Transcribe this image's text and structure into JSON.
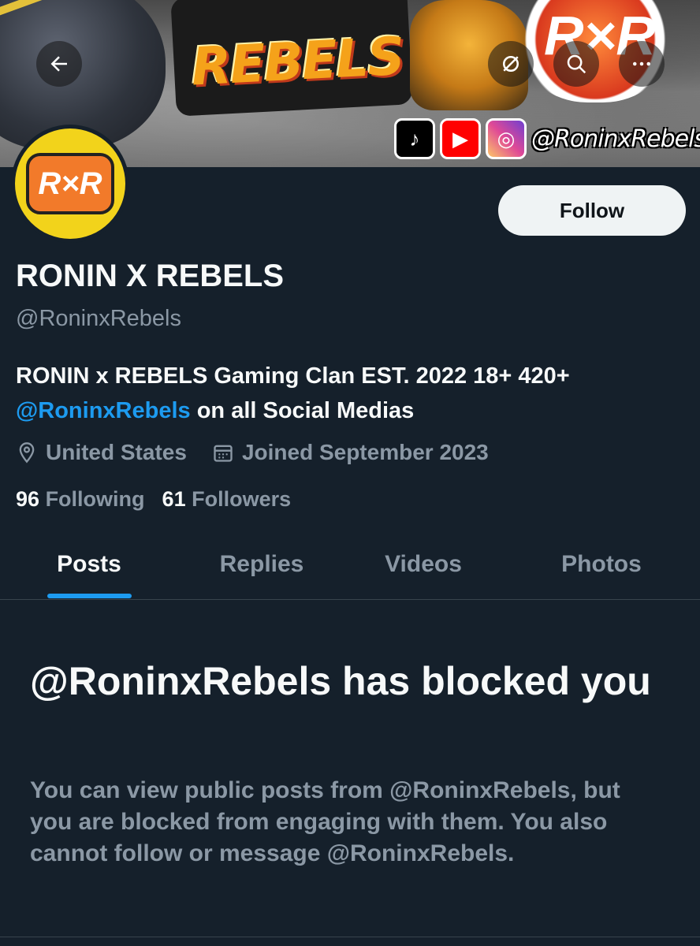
{
  "banner": {
    "logo_text": "REBELS",
    "badge_text": "R×R",
    "social_handle": "@RoninxRebels"
  },
  "header": {
    "back_icon": "←",
    "hide_icon": "⌀",
    "search_icon": "⚲",
    "more_icon": "···"
  },
  "avatar": {
    "logo_text": "R×R"
  },
  "profile": {
    "follow_label": "Follow",
    "name": "RONIN X REBELS",
    "handle": "@RoninxRebels",
    "bio_text": "RONIN x REBELS Gaming Clan EST. 2022 18+ 420+",
    "bio_mention": "@RoninxRebels",
    "bio_suffix": " on all Social Medias",
    "location": "United States",
    "joined": "Joined September 2023",
    "following_count": "96",
    "following_label": "Following",
    "followers_count": "61",
    "followers_label": "Followers"
  },
  "tabs": [
    {
      "label": "Posts",
      "active": true
    },
    {
      "label": "Replies",
      "active": false
    },
    {
      "label": "Videos",
      "active": false
    },
    {
      "label": "Photos",
      "active": false
    }
  ],
  "blocked": {
    "title": "@RoninxRebels has blocked you",
    "body": "You can view public posts from @RoninxRebels, but you are blocked from engaging with them. You also cannot follow or message @RoninxRebels."
  },
  "colors": {
    "background": "#15202b",
    "accent": "#1d9bf0",
    "secondary_text": "#8b98a5"
  }
}
